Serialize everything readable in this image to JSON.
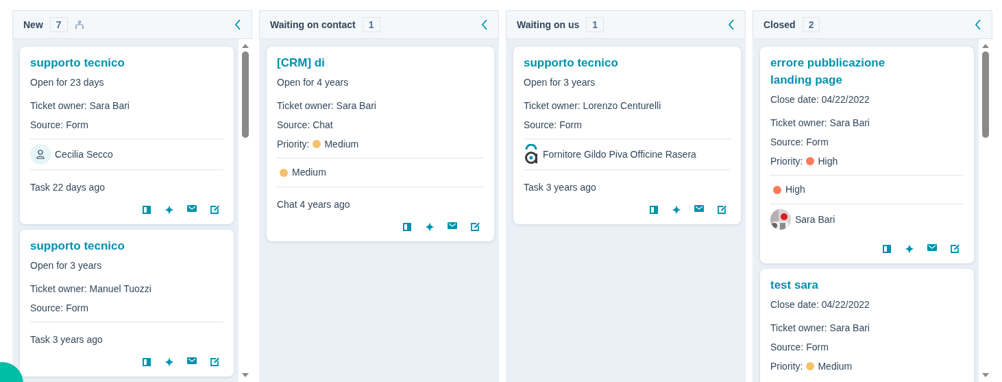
{
  "columns": [
    {
      "name": "New",
      "count": "7",
      "split_icon": true,
      "cards": [
        {
          "title": "supporto tecnico",
          "show_actions": true,
          "details": [
            {
              "kind": "text",
              "text": "Open for 23 days"
            },
            {
              "kind": "text",
              "text": "Ticket owner: Sara Bari"
            },
            {
              "kind": "text",
              "text": "Source: Form"
            }
          ],
          "associations": [
            {
              "kind": "contact",
              "name": "Cecilia Secco"
            }
          ],
          "activity": "Task 22 days ago"
        },
        {
          "title": "supporto tecnico",
          "show_actions": true,
          "details": [
            {
              "kind": "text",
              "text": "Open for 3 years"
            },
            {
              "kind": "text",
              "text": "Ticket owner: Manuel Tuozzi"
            },
            {
              "kind": "text",
              "text": "Source: Form"
            }
          ],
          "activity": "Task 3 years ago"
        }
      ]
    },
    {
      "name": "Waiting on contact",
      "count": "1",
      "split_icon": false,
      "cards": [
        {
          "title": "[CRM] di",
          "show_actions": true,
          "details": [
            {
              "kind": "text",
              "text": "Open for 4 years"
            },
            {
              "kind": "text",
              "text": "Ticket owner: Sara Bari"
            },
            {
              "kind": "text",
              "text": "Source: Chat"
            },
            {
              "kind": "priority",
              "text": "Priority:",
              "value": "Medium",
              "color": "#f5c26b"
            }
          ],
          "associations": [
            {
              "kind": "priority",
              "name": "Medium",
              "color": "#f5c26b"
            }
          ],
          "activity": "Chat 4 years ago"
        }
      ]
    },
    {
      "name": "Waiting on us",
      "count": "1",
      "split_icon": false,
      "cards": [
        {
          "title": "supporto tecnico",
          "show_actions": true,
          "details": [
            {
              "kind": "text",
              "text": "Open for 3 years"
            },
            {
              "kind": "text",
              "text": "Ticket owner: Lorenzo Centurelli"
            },
            {
              "kind": "text",
              "text": "Source: Form"
            }
          ],
          "associations": [
            {
              "kind": "company",
              "name": "Fornitore Gildo Piva Officine Rasera"
            }
          ],
          "activity": "Task 3 years ago"
        }
      ]
    },
    {
      "name": "Closed",
      "count": "2",
      "split_icon": false,
      "cards": [
        {
          "title": "errore pubblicazione landing page",
          "show_actions": true,
          "details": [
            {
              "kind": "text",
              "text": "Close date: 04/22/2022"
            },
            {
              "kind": "text",
              "text": "Ticket owner: Sara Bari"
            },
            {
              "kind": "text",
              "text": "Source: Form"
            },
            {
              "kind": "priority",
              "text": "Priority:",
              "value": "High",
              "color": "#ff7a59"
            }
          ],
          "associations": [
            {
              "kind": "priority",
              "name": "High",
              "color": "#ff7a59"
            },
            {
              "kind": "owner",
              "name": "Sara Bari"
            }
          ]
        },
        {
          "title": "test sara",
          "show_actions": false,
          "details": [
            {
              "kind": "text",
              "text": "Close date: 04/22/2022"
            },
            {
              "kind": "text",
              "text": "Ticket owner: Sara Bari"
            },
            {
              "kind": "text",
              "text": "Source: Form"
            },
            {
              "kind": "priority",
              "text": "Priority:",
              "value": "Medium",
              "color": "#f5c26b"
            }
          ]
        }
      ]
    }
  ]
}
